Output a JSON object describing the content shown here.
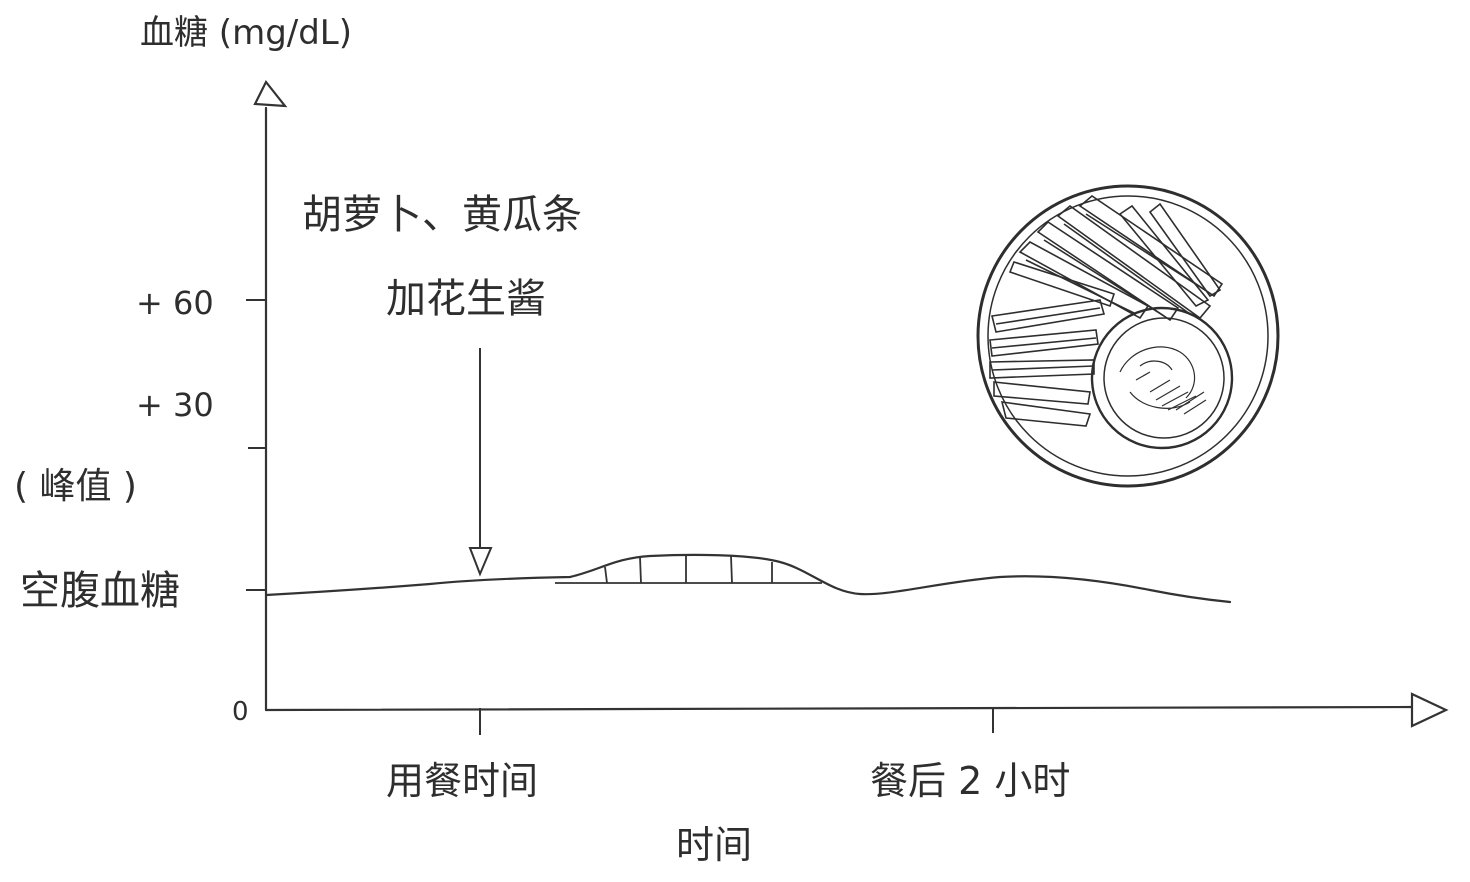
{
  "chart_data": {
    "type": "line",
    "ylabel": "血糖 (mg/dL)",
    "xlabel": "时间",
    "ylim": [
      0,
      80
    ],
    "yticks": [
      {
        "value": 0,
        "label": "0"
      },
      {
        "value": 0,
        "label": "空腹血糖",
        "note": "baseline"
      },
      {
        "value": 30,
        "label": "+ 30"
      },
      {
        "value": 60,
        "label": "+ 60"
      }
    ],
    "ytick_labels": {
      "zero": "0",
      "fasting": "空腹血糖",
      "peak": "( 峰值 )",
      "plus30": "+ 30",
      "plus60": "+ 60"
    },
    "xticks": [
      "用餐时间",
      "餐后 2 小时"
    ],
    "annotation": {
      "line1": "胡萝卜、黄瓜条",
      "line2": "加花生酱"
    },
    "series": [
      {
        "x_hours": [
          -1.0,
          -0.5,
          0.0,
          0.3,
          0.6,
          1.0,
          1.3,
          1.6,
          1.8,
          2.0,
          2.4,
          2.8
        ],
        "delta_mg_dl": [
          -3,
          -1,
          1,
          1,
          8,
          9,
          5,
          -3,
          -2,
          2,
          1,
          -4
        ]
      }
    ],
    "grid": false,
    "legend": "none"
  },
  "icons": {
    "food": "plate-of-vegetable-sticks-with-dip-icon"
  }
}
